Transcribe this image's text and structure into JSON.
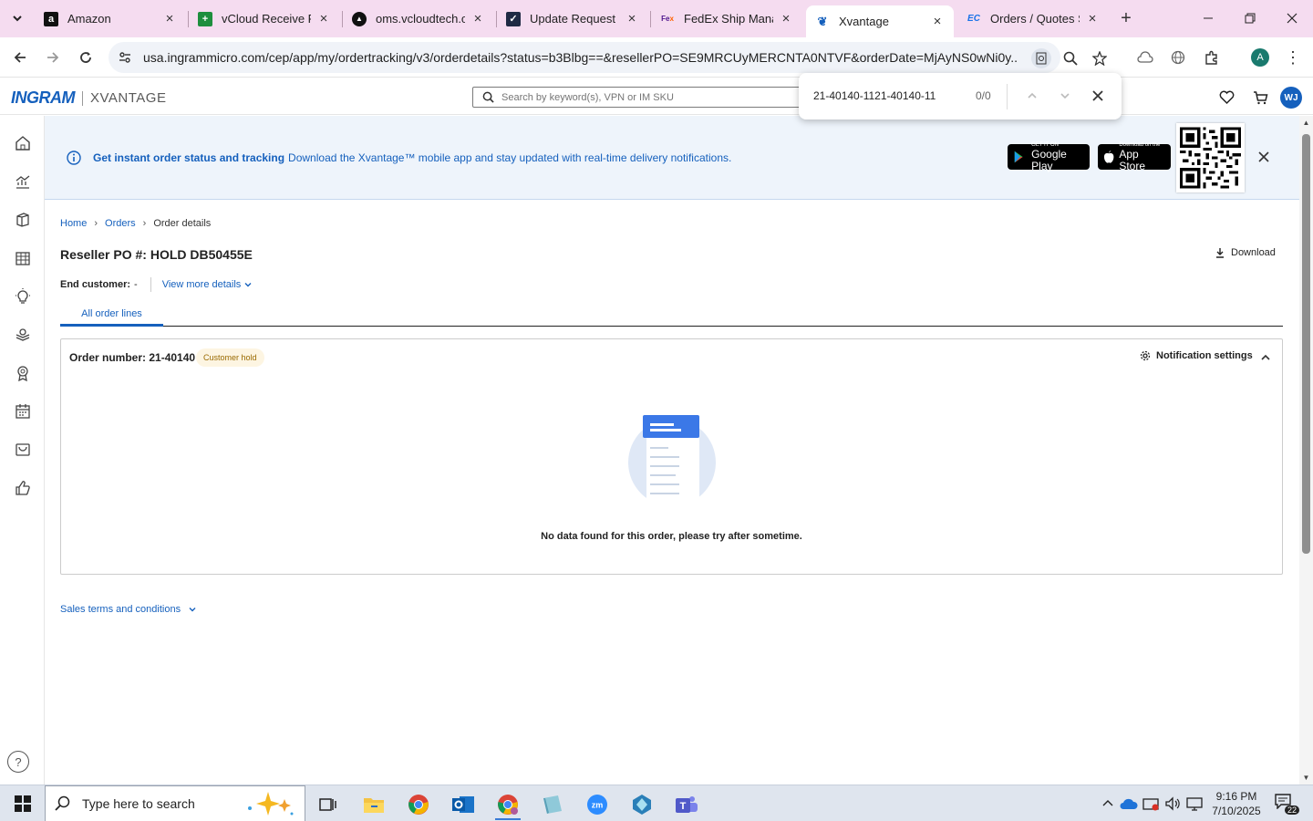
{
  "browser": {
    "tabs": [
      {
        "title": "Amazon",
        "favicon": "amazon-icon"
      },
      {
        "title": "vCloud Receive Fil",
        "favicon": "sheets-icon"
      },
      {
        "title": "oms.vcloudtech.or",
        "favicon": "triangle-icon"
      },
      {
        "title": "Update Request - ",
        "favicon": "check-icon"
      },
      {
        "title": "FedEx Ship Manag",
        "favicon": "fedex-icon"
      },
      {
        "title": "Xvantage",
        "favicon": "xvantage-icon",
        "active": true
      },
      {
        "title": "Orders / Quotes S",
        "favicon": "ec-icon"
      }
    ],
    "url": "usa.ingrammicro.com/cep/app/my/ordertracking/v3/orderdetails?status=b3Blbg==&resellerPO=SE9MRCUyMERCNTA0NTVF&orderDate=MjAyNS0wNi0y...",
    "profile_initial": "A"
  },
  "find": {
    "query": "21-40140-1121-40140-11",
    "count": "0/0"
  },
  "header": {
    "logo_brand": "INGRAM",
    "logo_product": "XVANTAGE",
    "search_placeholder": "Search by keyword(s), VPN or IM SKU",
    "user_initials": "WJ"
  },
  "banner": {
    "title": "Get instant order status and tracking",
    "text": "Download the Xvantage™ mobile app and stay updated with real-time delivery notifications.",
    "google_small": "GET IT ON",
    "google_large": "Google Play",
    "apple_small": "Download on the",
    "apple_large": "App Store"
  },
  "breadcrumb": [
    "Home",
    "Orders",
    "Order details"
  ],
  "page": {
    "title": "Reseller PO #: HOLD DB50455E",
    "download_label": "Download",
    "end_customer_label": "End customer:",
    "end_customer_value": "-",
    "view_more": "View more details",
    "tab_all_lines": "All order lines"
  },
  "order": {
    "number_label": "Order number: 21-40140",
    "status": "Customer hold",
    "notification_settings": "Notification settings",
    "empty_message": "No data found for this order, please try after sometime."
  },
  "terms_label": "Sales terms and conditions",
  "help_label": "?",
  "taskbar": {
    "search_placeholder": "Type here to search",
    "time": "9:16 PM",
    "date": "7/10/2025",
    "notification_count": "22"
  },
  "colors": {
    "accent": "#1560bd",
    "banner_bg": "#eef4fb",
    "tabstrip_bg": "#f5dcf0",
    "badge_bg": "#fdf5e2",
    "badge_text": "#9a6a00"
  }
}
